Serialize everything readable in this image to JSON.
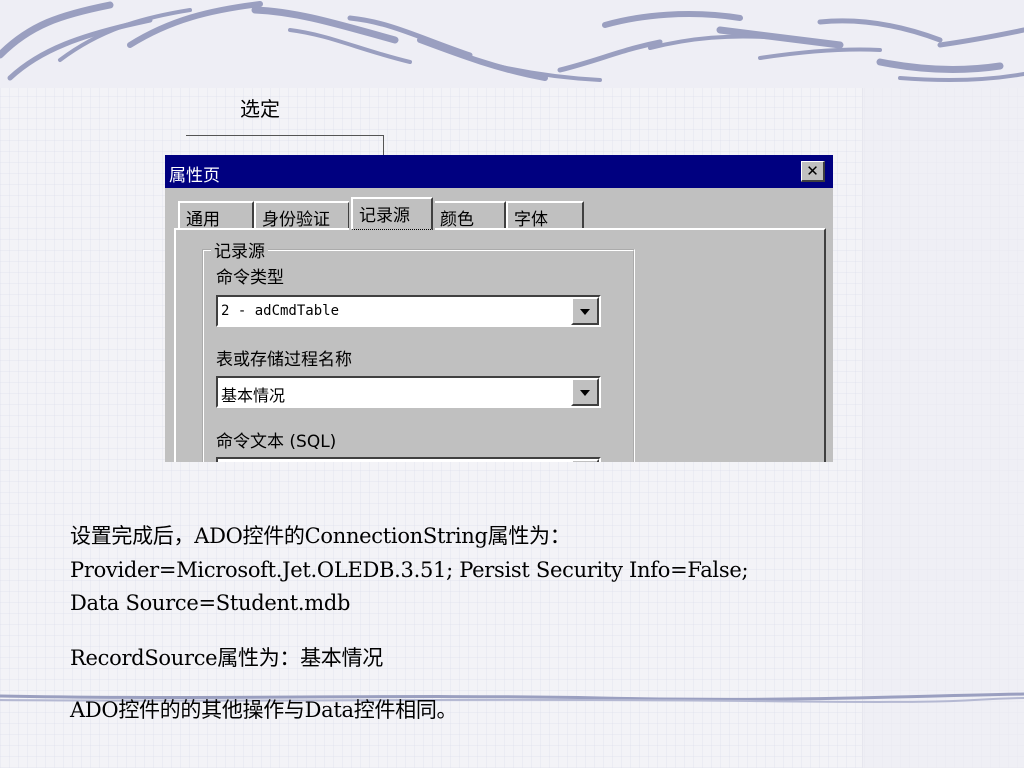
{
  "callout": {
    "label": "选定"
  },
  "dialog": {
    "title": "属性页",
    "close_symbol": "✕",
    "tabs": [
      {
        "label": "通用"
      },
      {
        "label": "身份验证"
      },
      {
        "label": "记录源",
        "active": true
      },
      {
        "label": "颜色"
      },
      {
        "label": "字体"
      }
    ],
    "group": {
      "title": "记录源",
      "command_type_label": "命令类型",
      "command_type_value": "2 - adCmdTable",
      "table_label": "表或存储过程名称",
      "table_value": "基本情况",
      "command_text_label": "命令文本 (SQL)",
      "command_text_value": ""
    }
  },
  "body": {
    "line1": "设置完成后，ADO控件的ConnectionString属性为：",
    "line2": "Provider=Microsoft.Jet.OLEDB.3.51; Persist Security Info=False;",
    "line3": "Data Source=Student.mdb",
    "line4": "RecordSource属性为：基本情况",
    "line5": "ADO控件的的其他操作与Data控件相同。"
  },
  "colors": {
    "titlebar": "#000080",
    "dialog_face": "#c0c0c0",
    "decor_stroke": "#9a9fc0"
  },
  "icons": {
    "close": "close-icon",
    "dropdown": "chevron-down-icon",
    "callout_arrow": "arrow-down-icon"
  }
}
